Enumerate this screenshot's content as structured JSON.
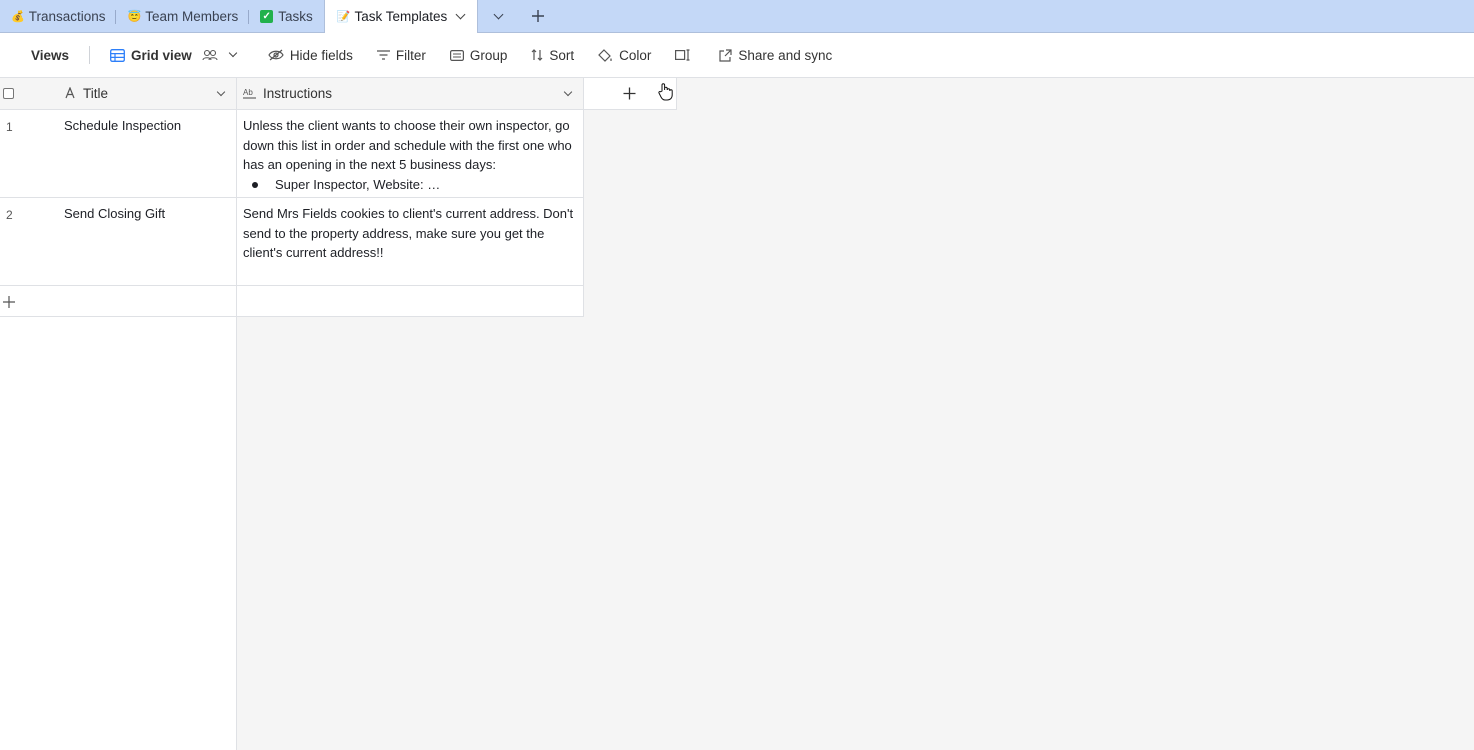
{
  "tabs": [
    {
      "emoji": "💰",
      "label": "Transactions"
    },
    {
      "emoji": "😇",
      "label": "Team Members"
    },
    {
      "emoji": "✓",
      "label": "Tasks"
    },
    {
      "emoji": "📝",
      "label": "Task Templates"
    }
  ],
  "toolbar": {
    "views_label": "Views",
    "grid_view_label": "Grid view",
    "hide_fields_label": "Hide fields",
    "filter_label": "Filter",
    "group_label": "Group",
    "sort_label": "Sort",
    "color_label": "Color",
    "share_label": "Share and sync"
  },
  "columns": {
    "title": "Title",
    "instructions": "Instructions"
  },
  "rows": [
    {
      "num": "1",
      "title": "Schedule Inspection",
      "instructions": "Unless the client wants to choose their own inspector, go down this list in order and schedule with the first one who has an opening in the next 5 business days:",
      "bullet": "Super Inspector, Website: …"
    },
    {
      "num": "2",
      "title": "Send Closing Gift",
      "instructions": "Send Mrs Fields cookies to client's current address. Don't send to the property address, make sure you get the client's current address!!"
    }
  ],
  "colors": {
    "tabbar_bg": "#c4d8f7",
    "grid_bg": "#f5f5f5",
    "accent_blue": "#2d7ff9"
  }
}
